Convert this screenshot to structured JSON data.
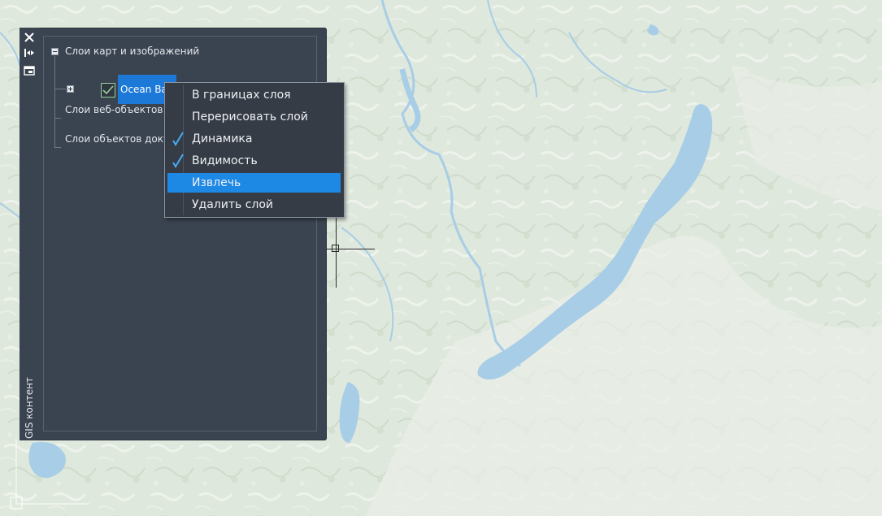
{
  "palette": {
    "title": "GIS контент",
    "tree": {
      "root_label": "Слои карт и изображений",
      "layer_name": "Ocean Base",
      "web_objects_label": "Слои веб-объектов",
      "doc_objects_label": "Слои объектов доку"
    }
  },
  "context_menu": {
    "items": [
      {
        "label": "В границах слоя",
        "checked": false,
        "highlighted": false
      },
      {
        "label": "Перерисовать слой",
        "checked": false,
        "highlighted": false
      },
      {
        "label": "Динамика",
        "checked": true,
        "highlighted": false
      },
      {
        "label": "Видимость",
        "checked": true,
        "highlighted": false
      },
      {
        "label": "Извлечь",
        "checked": false,
        "highlighted": true
      },
      {
        "label": "Удалить слой",
        "checked": false,
        "highlighted": false
      }
    ]
  },
  "icons": {
    "close": "close-icon",
    "autohide": "autohide-icon",
    "properties": "properties-icon",
    "checkbox": "checkbox-checked-icon",
    "layer_zoom": "layer-zoom-icon",
    "layer_settings": "layer-settings-icon",
    "check": "check-icon"
  },
  "colors": {
    "panel_bg": "#3a4350",
    "selection": "#1d79d8",
    "menu_highlight": "#1e88e5",
    "map_land": "#dfe8dd",
    "map_water": "#a8cde6"
  }
}
